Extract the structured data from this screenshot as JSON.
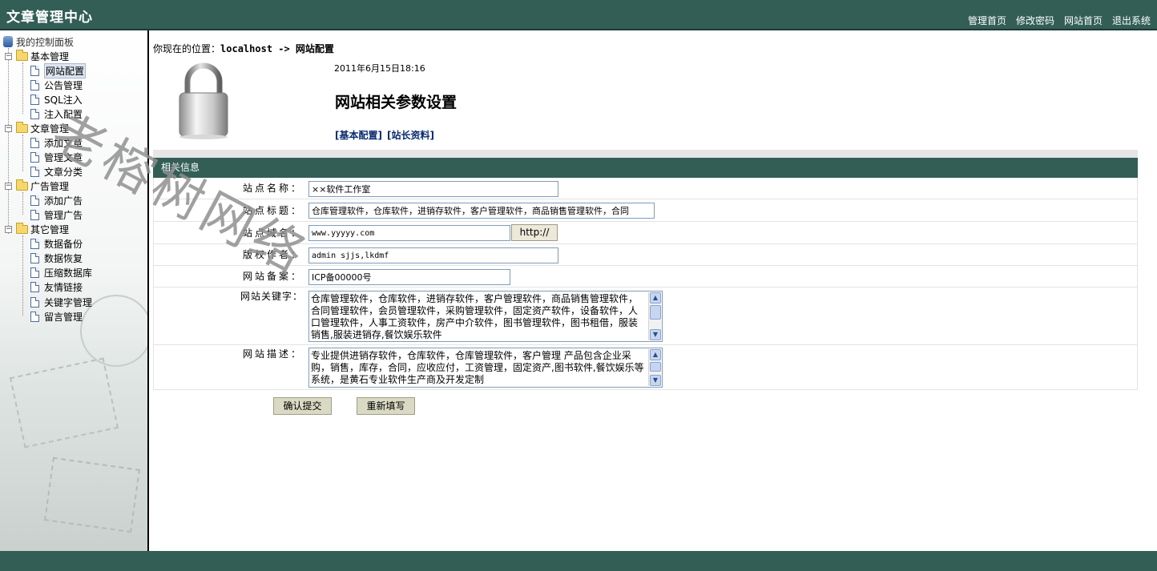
{
  "header": {
    "title": "文章管理中心",
    "nav": [
      "管理首页",
      "修改密码",
      "网站首页",
      "退出系统"
    ]
  },
  "sidebar": {
    "root": "我的控制面板",
    "groups": [
      {
        "label": "基本管理",
        "items": [
          "网站配置",
          "公告管理",
          "SQL注入",
          "注入配置"
        ]
      },
      {
        "label": "文章管理",
        "items": [
          "添加文章",
          "管理文章",
          "文章分类"
        ]
      },
      {
        "label": "广告管理",
        "items": [
          "添加广告",
          "管理广告"
        ]
      },
      {
        "label": "其它管理",
        "items": [
          "数据备份",
          "数据恢复",
          "压缩数据库",
          "友情链接",
          "关键字管理",
          "留言管理"
        ]
      }
    ],
    "selected": "网站配置"
  },
  "main": {
    "location_prefix": "你现在的位置：",
    "location_path": "localhost -> 网站配置",
    "date": "2011年6月15日18:16",
    "heading": "网站相关参数设置",
    "sub_links": [
      "[基本配置]",
      "[站长资料]"
    ],
    "section_title": "相关信息"
  },
  "form": {
    "site_name_label": "站点名称：",
    "site_name_value": "××软件工作室",
    "site_title_label": "站点标题：",
    "site_title_value": "仓库管理软件，仓库软件，进销存软件，客户管理软件，商品销售管理软件，合同",
    "site_domain_label": "站点域名：",
    "site_domain_value": "www.yyyyy.com",
    "http_button": "http://",
    "copyright_label": "版权作者：",
    "copyright_value": "admin sjjs,lkdmf",
    "icp_label": "网站备案：",
    "icp_value": "ICP备00000号",
    "keywords_label": "网站关键字：",
    "keywords_value": "仓库管理软件，仓库软件，进销存软件，客户管理软件，商品销售管理软件，合同管理软件，会员管理软件，采购管理软件，固定资产软件，设备软件，人口管理软件，人事工资软件，房产中介软件，图书管理软件，图书租借，服装销售,服装进销存,餐饮娱乐软件",
    "description_label": "网站描述：",
    "description_value": "专业提供进销存软件，仓库软件，仓库管理软件，客户管理 产品包含企业采购，销售，库存，合同，应收应付，工资管理，固定资产,图书软件,餐饮娱乐等系统，是黄石专业软件生产商及开发定制",
    "submit_button": "确认提交",
    "reset_button": "重新填写"
  },
  "watermark": "老榕树网络",
  "colors": {
    "header_bg": "#325e56",
    "section_bg": "#325e56"
  }
}
